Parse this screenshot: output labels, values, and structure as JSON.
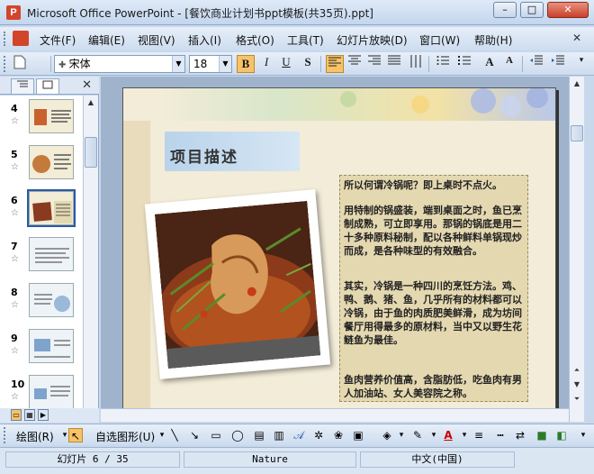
{
  "window": {
    "title": "Microsoft Office PowerPoint - [餐饮商业计划书ppt模板(共35页).ppt]",
    "app_icon": "P",
    "controls": {
      "minimize": "–",
      "maximize": "□",
      "close": "✕"
    }
  },
  "menu": {
    "items": [
      "文件(F)",
      "编辑(E)",
      "视图(V)",
      "插入(I)",
      "格式(O)",
      "工具(T)",
      "幻灯片放映(D)",
      "窗口(W)",
      "帮助(H)"
    ],
    "end_close": "✕"
  },
  "toolbar": {
    "font_name": "宋体",
    "font_size": "18",
    "bold": "B",
    "italic": "I",
    "underline": "U",
    "shadow": "S",
    "increase_font": "A",
    "decrease_font": "A"
  },
  "left_panel": {
    "tab_outline_icon": "outline-icon",
    "tab_slides_icon": "slides-icon",
    "close": "✕",
    "thumbnails": [
      {
        "number": "4"
      },
      {
        "number": "5"
      },
      {
        "number": "6",
        "selected": true
      },
      {
        "number": "7"
      },
      {
        "number": "8"
      },
      {
        "number": "9"
      },
      {
        "number": "10"
      }
    ],
    "star": "☆"
  },
  "slide": {
    "title": "项目描述",
    "paragraphs": [
      "所以何谓冷锅呢？即上桌时不点火。",
      "用特制的锅盛装，端到桌面之时，鱼已烹制成熟，可立即享用。那锅的锅底是用二十多种原料秘制，配以各种鲜料单锅现炒而成，是各种味型的有效融合。",
      "其实，冷锅是一种四川的烹饪方法。鸡、鸭、鹅、猪、鱼，几乎所有的材料都可以冷锅，由于鱼的肉质肥美鲜滑，成为坊间餐厅用得最多的原材料，当中又以野生花鲢鱼为最佳。",
      "鱼肉营养价值高，含脂肪低，吃鱼肉有男人加油站、女人美容院之称。"
    ]
  },
  "drawing_toolbar": {
    "draw_menu": "绘图(R)",
    "autoshapes": "自选图形(U)"
  },
  "status": {
    "slide_info": "幻灯片 6 / 35",
    "design": "Nature",
    "language": "中文(中国)"
  },
  "colors": {
    "accent": "#f6c26a",
    "titlebar": "#c3d6ee",
    "slide_bg": "#f2ecd8",
    "textbox_bg": "#e4d8b0",
    "title_box": "#b9d3ea"
  }
}
